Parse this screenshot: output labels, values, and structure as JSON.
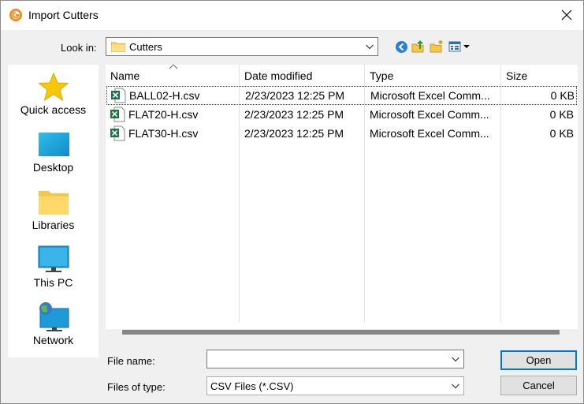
{
  "window": {
    "title": "Import Cutters",
    "accent": "#0078d7"
  },
  "lookin": {
    "label": "Look in:",
    "value": "Cutters"
  },
  "places": [
    {
      "label": "Quick access",
      "icon": "star-icon"
    },
    {
      "label": "Desktop",
      "icon": "desktop-icon"
    },
    {
      "label": "Libraries",
      "icon": "libraries-folder-icon"
    },
    {
      "label": "This PC",
      "icon": "monitor-icon"
    },
    {
      "label": "Network",
      "icon": "network-icon"
    }
  ],
  "columns": {
    "name": "Name",
    "date": "Date modified",
    "type": "Type",
    "size": "Size"
  },
  "files": [
    {
      "name": "BALL02-H.csv",
      "date": "2/23/2023 12:25 PM",
      "type": "Microsoft Excel Comm...",
      "size": "0 KB"
    },
    {
      "name": "FLAT20-H.csv",
      "date": "2/23/2023 12:25 PM",
      "type": "Microsoft Excel Comm...",
      "size": "0 KB"
    },
    {
      "name": "FLAT30-H.csv",
      "date": "2/23/2023 12:25 PM",
      "type": "Microsoft Excel Comm...",
      "size": "0 KB"
    }
  ],
  "filename": {
    "label": "File name:",
    "value": ""
  },
  "filetype": {
    "label": "Files of type:",
    "value": "CSV Files (*.CSV)"
  },
  "buttons": {
    "open": "Open",
    "cancel": "Cancel"
  }
}
